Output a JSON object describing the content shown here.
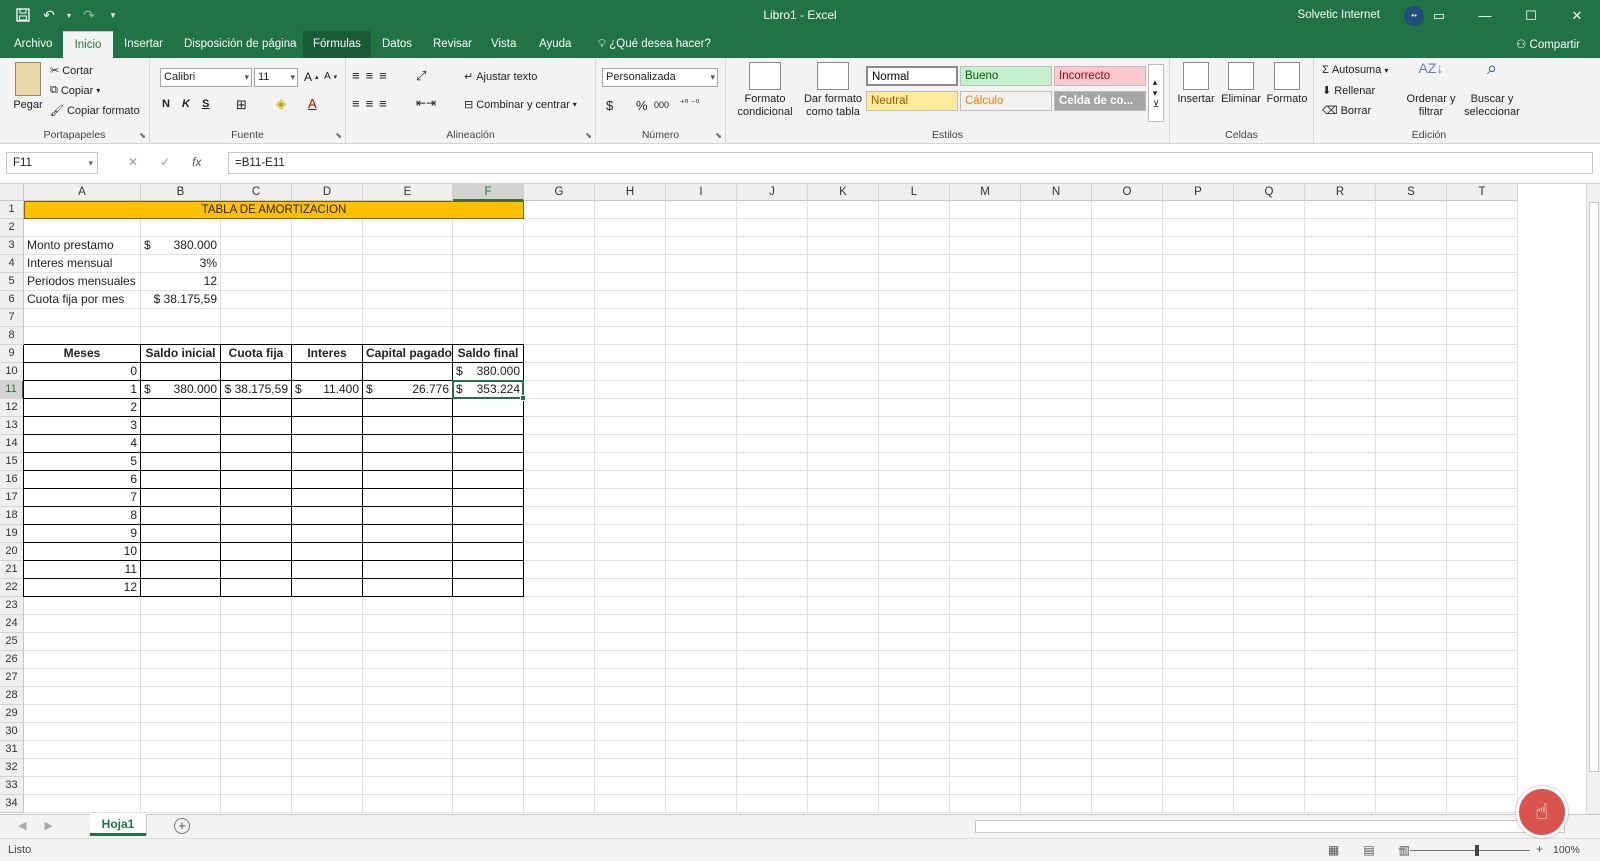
{
  "title_bar": {
    "document_title": "Libro1  -  Excel",
    "user": "Solvetic Internet",
    "avatar_initials": "••"
  },
  "tabs": [
    "Archivo",
    "Inicio",
    "Insertar",
    "Disposición de página",
    "Fórmulas",
    "Datos",
    "Revisar",
    "Vista",
    "Ayuda"
  ],
  "tell_me": "¿Qué desea hacer?",
  "share": "Compartir",
  "ribbon": {
    "clipboard": {
      "label": "Portapapeles",
      "paste": "Pegar",
      "cut": "Cortar",
      "copy": "Copiar",
      "format_painter": "Copiar formato"
    },
    "font": {
      "label": "Fuente",
      "family": "Calibri",
      "size": "11",
      "bold": "N",
      "italic": "K",
      "underline": "S"
    },
    "alignment": {
      "label": "Alineación",
      "wrap": "Ajustar texto",
      "merge": "Combinar y centrar"
    },
    "number": {
      "label": "Número",
      "format": "Personalizada",
      "currency": "$",
      "percent": "%",
      "thousands": "000"
    },
    "styles": {
      "label": "Estilos",
      "conditional": "Formato condicional",
      "as_table": "Dar formato como tabla",
      "cells": [
        {
          "name": "Normal",
          "bg": "#ffffff",
          "fg": "#000000"
        },
        {
          "name": "Bueno",
          "bg": "#c6efce",
          "fg": "#006100"
        },
        {
          "name": "Incorrecto",
          "bg": "#ffc7ce",
          "fg": "#9c0006"
        },
        {
          "name": "Neutral",
          "bg": "#ffeb9c",
          "fg": "#9c5700"
        },
        {
          "name": "Cálculo",
          "bg": "#f2f2f2",
          "fg": "#fa7d00"
        },
        {
          "name": "Celda de co...",
          "bg": "#a5a5a5",
          "fg": "#ffffff"
        }
      ]
    },
    "cells": {
      "label": "Celdas",
      "insert": "Insertar",
      "delete": "Eliminar",
      "format": "Formato"
    },
    "editing": {
      "label": "Edición",
      "autosum": "Autosuma",
      "fill": "Rellenar",
      "clear": "Borrar",
      "sort": "Ordenar y filtrar",
      "find": "Buscar y seleccionar"
    }
  },
  "formula_bar": {
    "name_box": "F11",
    "formula": "=B11-E11"
  },
  "columns": [
    "A",
    "B",
    "C",
    "D",
    "E",
    "F",
    "G",
    "H",
    "I",
    "J",
    "K",
    "L",
    "M",
    "N",
    "O",
    "P",
    "Q",
    "R",
    "S",
    "T"
  ],
  "selected_cell": {
    "col": "F",
    "row": 11
  },
  "sheet": {
    "title": "TABLA DE AMORTIZACION",
    "params": [
      {
        "label": "Monto prestamo",
        "currency": "$",
        "value": "380.000"
      },
      {
        "label": "Interes mensual",
        "currency": "",
        "value": "3%"
      },
      {
        "label": "Periodos mensuales",
        "currency": "",
        "value": "12"
      },
      {
        "label": "Cuota fija por mes",
        "currency": "",
        "value": "$ 38.175,59"
      }
    ],
    "table_headers": [
      "Meses",
      "Saldo inicial",
      "Cuota fija",
      "Interes",
      "Capital pagado",
      "Saldo final"
    ],
    "table_rows": [
      {
        "mes": "0",
        "saldo_inicial": "",
        "cuota": "",
        "interes": "",
        "capital": "",
        "saldo_final": "380.000"
      },
      {
        "mes": "1",
        "saldo_inicial": "380.000",
        "cuota": "$ 38.175,59",
        "interes": "11.400",
        "capital": "26.776",
        "saldo_final": "353.224"
      },
      {
        "mes": "2"
      },
      {
        "mes": "3"
      },
      {
        "mes": "4"
      },
      {
        "mes": "5"
      },
      {
        "mes": "6"
      },
      {
        "mes": "7"
      },
      {
        "mes": "8"
      },
      {
        "mes": "9"
      },
      {
        "mes": "10"
      },
      {
        "mes": "11"
      },
      {
        "mes": "12"
      }
    ]
  },
  "sheet_tab": "Hoja1",
  "status": "Listo",
  "zoom": "100%",
  "colors": {
    "brand": "#217346",
    "title_band": "#ffc000"
  }
}
